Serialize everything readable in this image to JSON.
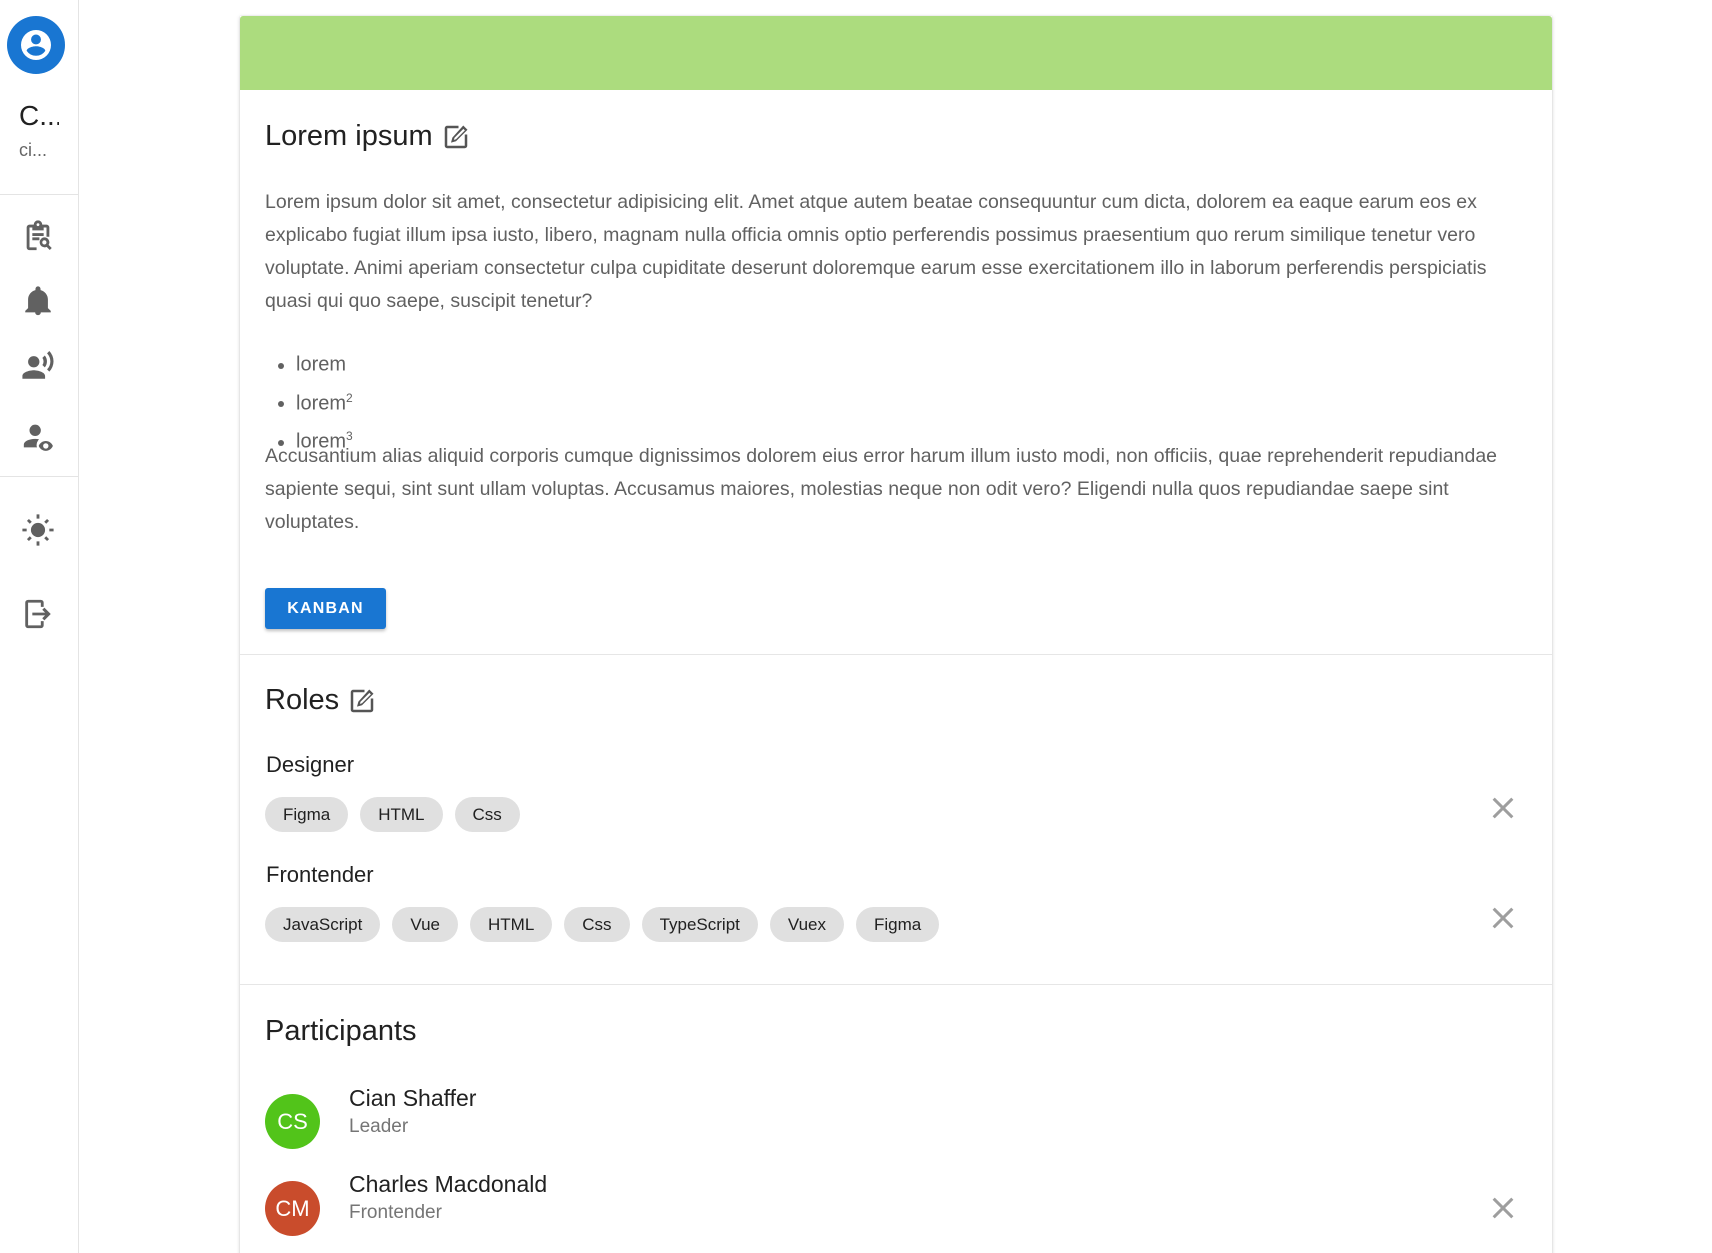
{
  "sidebar": {
    "user_name": "C...",
    "user_sub": "ci...",
    "icons": [
      "account-circle-icon",
      "clipboard-search-icon",
      "bell-icon",
      "account-voice-icon",
      "account-eye-icon",
      "brightness-icon",
      "logout-icon"
    ]
  },
  "colors": {
    "banner": "#acdc7e",
    "accent": "#1976d2",
    "avatar_cs": "#52c41a",
    "avatar_cm": "#c94c2c"
  },
  "project": {
    "title": "Lorem ipsum",
    "paragraph1": "Lorem ipsum dolor sit amet, consectetur adipisicing elit. Amet atque autem beatae consequuntur cum dicta, dolorem ea eaque earum eos ex explicabo fugiat illum ipsa iusto, libero, magnam nulla officia omnis optio perferendis possimus praesentium quo rerum similique tenetur vero voluptate. Animi aperiam consectetur culpa cupiditate deserunt doloremque earum esse exercitationem illo in laborum perferendis perspiciatis quasi qui quo saepe, suscipit tenetur?",
    "list": [
      {
        "text": "lorem",
        "sup": ""
      },
      {
        "text": "lorem",
        "sup": "2"
      },
      {
        "text": "lorem",
        "sup": "3"
      }
    ],
    "paragraph2": "Accusantium alias aliquid corporis cumque dignissimos dolorem eius error harum illum iusto modi, non officiis, quae reprehenderit repudiandae sapiente sequi, sint sunt ullam voluptas. Accusamus maiores, molestias neque non odit vero? Eligendi nulla quos repudiandae saepe sint voluptates.",
    "kanban_label": "KANBAN"
  },
  "roles": {
    "title": "Roles",
    "items": [
      {
        "name": "Designer",
        "skills": [
          "Figma",
          "HTML",
          "Css"
        ]
      },
      {
        "name": "Frontender",
        "skills": [
          "JavaScript",
          "Vue",
          "HTML",
          "Css",
          "TypeScript",
          "Vuex",
          "Figma"
        ]
      }
    ]
  },
  "participants": {
    "title": "Participants",
    "items": [
      {
        "initials": "CS",
        "name": "Cian Shaffer",
        "role": "Leader"
      },
      {
        "initials": "CM",
        "name": "Charles Macdonald",
        "role": "Frontender"
      }
    ]
  }
}
